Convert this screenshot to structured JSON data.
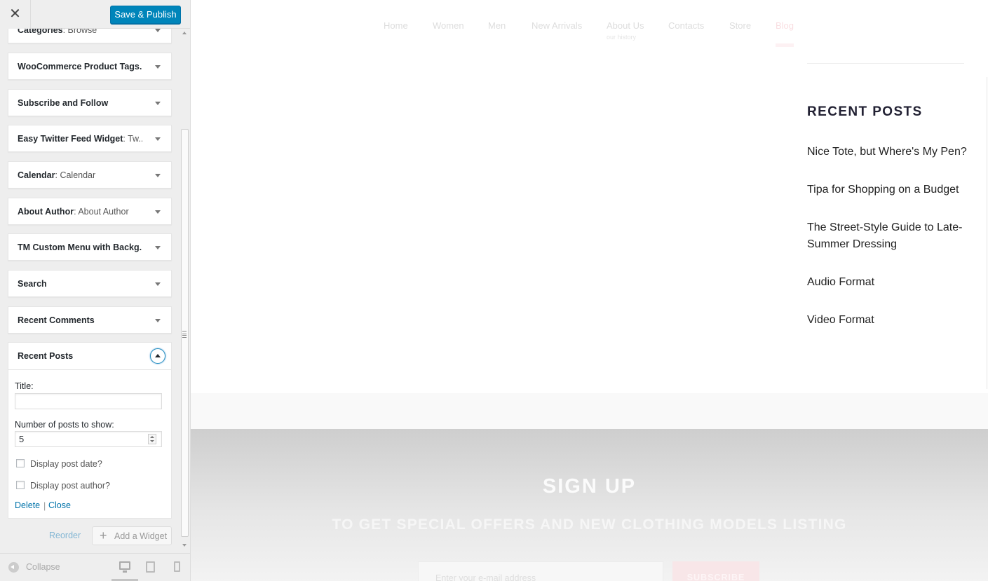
{
  "sidebar": {
    "close_label": "✕",
    "publish_label": "Save & Publish",
    "widgets": [
      {
        "title": "Categories",
        "subtitle": ": Browse"
      },
      {
        "title": "WooCommerce Product Tags...",
        "subtitle": ""
      },
      {
        "title": "Subscribe and Follow",
        "subtitle": ""
      },
      {
        "title": "Easy Twitter Feed Widget",
        "subtitle": ": Tw..."
      },
      {
        "title": "Calendar",
        "subtitle": ": Calendar"
      },
      {
        "title": "About Author",
        "subtitle": ": About Author"
      },
      {
        "title": "TM Custom Menu with Backg...",
        "subtitle": ""
      },
      {
        "title": "Search",
        "subtitle": ""
      },
      {
        "title": "Recent Comments",
        "subtitle": ""
      }
    ],
    "open_widget": {
      "title": "Recent Posts",
      "title_field_label": "Title:",
      "title_field_value": "",
      "count_label": "Number of posts to show:",
      "count_value": "5",
      "show_date_label": "Display post date?",
      "show_author_label": "Display post author?",
      "delete_label": "Delete",
      "separator": "|",
      "close_label": "Close"
    },
    "reorder_label": "Reorder",
    "add_widget_label": "Add a Widget",
    "add_widget_icon": "+",
    "collapse_label": "Collapse"
  },
  "preview": {
    "nav": [
      {
        "label": "Home"
      },
      {
        "label": "Women"
      },
      {
        "label": "Men"
      },
      {
        "label": "New Arrivals"
      },
      {
        "label": "About Us"
      },
      {
        "label": "Contacts"
      },
      {
        "label": "Store"
      },
      {
        "label": "Blog"
      }
    ],
    "nav_about_sub": "our history",
    "recent_posts_heading": "RECENT POSTS",
    "recent_posts": [
      "Nice Tote, but Where's My Pen?",
      "Tipa for Shopping on a Budget",
      "The Street-Style Guide to Late-Summer Dressing",
      "Audio Format",
      "Video Format"
    ],
    "signup_title": "SIGN UP",
    "signup_subtitle": "TO GET SPECIAL OFFERS AND NEW CLOTHING MODELS LISTING",
    "email_placeholder": "Enter your e-mail address",
    "subscribe_label": "SUBSCRIBE"
  },
  "colors": {
    "publish_button": "#0085ba",
    "link": "#0073aa",
    "nav_active": "#e25a6c",
    "heading": "#222133"
  },
  "icons": {
    "close": "close-icon",
    "collapse": "collapse-arrow-icon",
    "devices": [
      "desktop-icon",
      "tablet-icon",
      "mobile-icon"
    ]
  }
}
